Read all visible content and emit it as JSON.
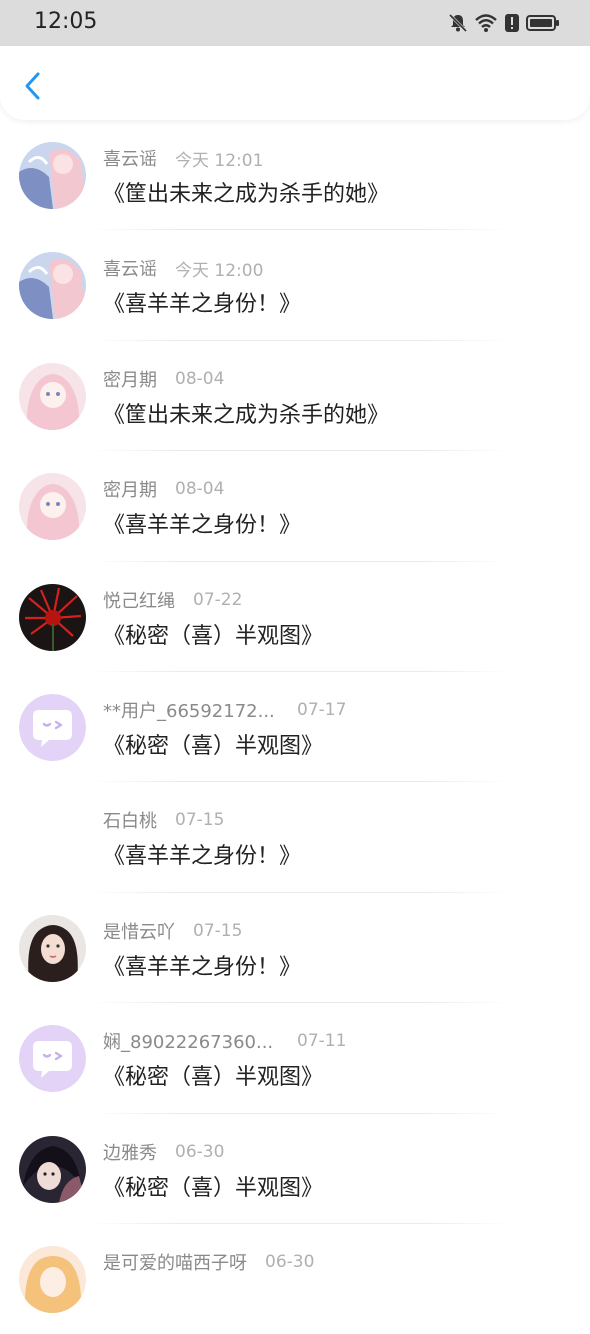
{
  "status_bar": {
    "time": "12:05",
    "icons": [
      "bell-muted-icon",
      "wifi-icon",
      "alert-icon",
      "battery-icon"
    ]
  },
  "header": {
    "back_icon": "back-chevron-icon",
    "accent": "#2196f3"
  },
  "list": [
    {
      "name": "喜云谣",
      "date": "今天 12:01",
      "title": "《筐出未来之成为杀手的她》"
    },
    {
      "name": "喜云谣",
      "date": "今天 12:00",
      "title": "《喜羊羊之身份！》"
    },
    {
      "name": "密月期",
      "date": "08-04",
      "title": "《筐出未来之成为杀手的她》"
    },
    {
      "name": "密月期",
      "date": "08-04",
      "title": "《喜羊羊之身份！》"
    },
    {
      "name": "悦己红绳",
      "date": "07-22",
      "title": "《秘密（喜）半观图》"
    },
    {
      "name": "**用户_66592172...",
      "date": "07-17",
      "title": "《秘密（喜）半观图》"
    },
    {
      "name": "石白桃",
      "date": "07-15",
      "title": "《喜羊羊之身份！》"
    },
    {
      "name": "是惜云吖",
      "date": "07-15",
      "title": "《喜羊羊之身份！》"
    },
    {
      "name": "娴_89022267360...",
      "date": "07-11",
      "title": "《秘密（喜）半观图》"
    },
    {
      "name": "边雅秀",
      "date": "06-30",
      "title": "《秘密（喜）半观图》"
    },
    {
      "name": "是可爱的喵西子呀",
      "date": "06-30",
      "title": ""
    }
  ]
}
